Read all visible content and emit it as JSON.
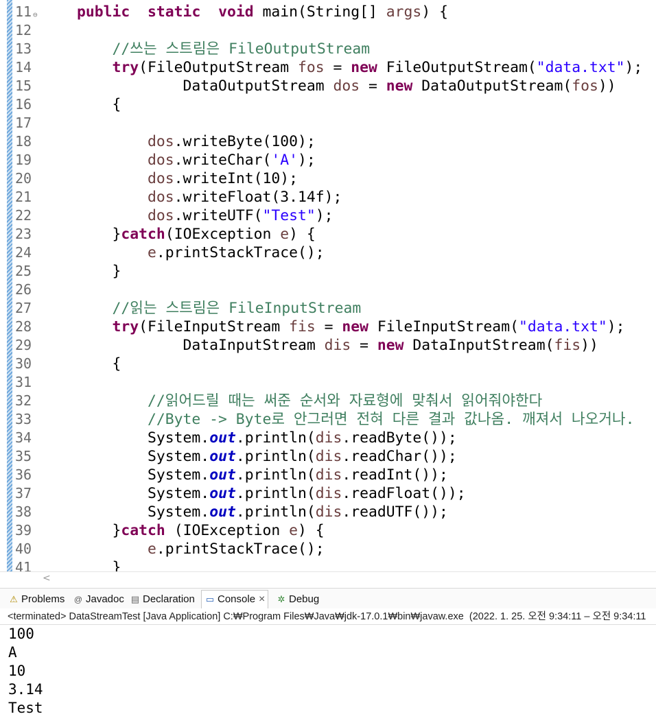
{
  "editor": {
    "lines": [
      {
        "num": "11",
        "fold": "⊖",
        "segs": [
          [
            "kw",
            "public"
          ],
          [
            "",
            "  "
          ],
          [
            "kw",
            "static"
          ],
          [
            "",
            "  "
          ],
          [
            "kw",
            "void"
          ],
          [
            "",
            " main(String[] "
          ],
          [
            "var",
            "args"
          ],
          [
            "",
            ") {"
          ]
        ]
      },
      {
        "num": "12",
        "segs": []
      },
      {
        "num": "13",
        "segs": [
          [
            "cmt",
            "    //쓰는 스트림은 FileOutputStream"
          ]
        ]
      },
      {
        "num": "14",
        "segs": [
          [
            "",
            "    "
          ],
          [
            "kw",
            "try"
          ],
          [
            "",
            "(FileOutputStream "
          ],
          [
            "var",
            "fos"
          ],
          [
            "",
            " = "
          ],
          [
            "kw",
            "new"
          ],
          [
            "",
            " FileOutputStream("
          ],
          [
            "str",
            "\"data.txt\""
          ],
          [
            "",
            ");"
          ]
        ]
      },
      {
        "num": "15",
        "segs": [
          [
            "",
            "            DataOutputStream "
          ],
          [
            "var",
            "dos"
          ],
          [
            "",
            " = "
          ],
          [
            "kw",
            "new"
          ],
          [
            "",
            " DataOutputStream("
          ],
          [
            "var",
            "fos"
          ],
          [
            "",
            "))"
          ]
        ]
      },
      {
        "num": "16",
        "segs": [
          [
            "",
            "    {"
          ]
        ]
      },
      {
        "num": "17",
        "segs": []
      },
      {
        "num": "18",
        "segs": [
          [
            "",
            "        "
          ],
          [
            "var",
            "dos"
          ],
          [
            "",
            ".writeByte(100);"
          ]
        ]
      },
      {
        "num": "19",
        "segs": [
          [
            "",
            "        "
          ],
          [
            "var",
            "dos"
          ],
          [
            "",
            ".writeChar("
          ],
          [
            "str",
            "'A'"
          ],
          [
            "",
            ");"
          ]
        ]
      },
      {
        "num": "20",
        "segs": [
          [
            "",
            "        "
          ],
          [
            "var",
            "dos"
          ],
          [
            "",
            ".writeInt(10);"
          ]
        ]
      },
      {
        "num": "21",
        "segs": [
          [
            "",
            "        "
          ],
          [
            "var",
            "dos"
          ],
          [
            "",
            ".writeFloat(3.14f);"
          ]
        ]
      },
      {
        "num": "22",
        "segs": [
          [
            "",
            "        "
          ],
          [
            "var",
            "dos"
          ],
          [
            "",
            ".writeUTF("
          ],
          [
            "str",
            "\"Test\""
          ],
          [
            "",
            ");"
          ]
        ]
      },
      {
        "num": "23",
        "segs": [
          [
            "",
            "    }"
          ],
          [
            "kw",
            "catch"
          ],
          [
            "",
            "(IOException "
          ],
          [
            "var",
            "e"
          ],
          [
            "",
            ") {"
          ]
        ]
      },
      {
        "num": "24",
        "segs": [
          [
            "",
            "        "
          ],
          [
            "var",
            "e"
          ],
          [
            "",
            ".printStackTrace();"
          ]
        ]
      },
      {
        "num": "25",
        "segs": [
          [
            "",
            "    }"
          ]
        ]
      },
      {
        "num": "26",
        "segs": []
      },
      {
        "num": "27",
        "segs": [
          [
            "cmt",
            "    //읽는 스트림은 FileInputStream"
          ]
        ]
      },
      {
        "num": "28",
        "segs": [
          [
            "",
            "    "
          ],
          [
            "kw",
            "try"
          ],
          [
            "",
            "(FileInputStream "
          ],
          [
            "var",
            "fis"
          ],
          [
            "",
            " = "
          ],
          [
            "kw",
            "new"
          ],
          [
            "",
            " FileInputStream("
          ],
          [
            "str",
            "\"data.txt\""
          ],
          [
            "",
            ");"
          ]
        ]
      },
      {
        "num": "29",
        "segs": [
          [
            "",
            "            DataInputStream "
          ],
          [
            "var",
            "dis"
          ],
          [
            "",
            " = "
          ],
          [
            "kw",
            "new"
          ],
          [
            "",
            " DataInputStream("
          ],
          [
            "var",
            "fis"
          ],
          [
            "",
            "))"
          ]
        ]
      },
      {
        "num": "30",
        "segs": [
          [
            "",
            "    {"
          ]
        ]
      },
      {
        "num": "31",
        "segs": []
      },
      {
        "num": "32",
        "segs": [
          [
            "cmt",
            "        //읽어드릴 때는 써준 순서와 자료형에 맞춰서 읽어줘야한다"
          ]
        ]
      },
      {
        "num": "33",
        "segs": [
          [
            "cmt",
            "        //Byte -> Byte로 안그러면 전혀 다른 결과 값나옴. 깨져서 나오거나."
          ]
        ]
      },
      {
        "num": "34",
        "segs": [
          [
            "",
            "        System."
          ],
          [
            "fld",
            "out"
          ],
          [
            "",
            ".println("
          ],
          [
            "var",
            "dis"
          ],
          [
            "",
            ".readByte());"
          ]
        ]
      },
      {
        "num": "35",
        "segs": [
          [
            "",
            "        System."
          ],
          [
            "fld",
            "out"
          ],
          [
            "",
            ".println("
          ],
          [
            "var",
            "dis"
          ],
          [
            "",
            ".readChar());"
          ]
        ]
      },
      {
        "num": "36",
        "segs": [
          [
            "",
            "        System."
          ],
          [
            "fld",
            "out"
          ],
          [
            "",
            ".println("
          ],
          [
            "var",
            "dis"
          ],
          [
            "",
            ".readInt());"
          ]
        ]
      },
      {
        "num": "37",
        "segs": [
          [
            "",
            "        System."
          ],
          [
            "fld",
            "out"
          ],
          [
            "",
            ".println("
          ],
          [
            "var",
            "dis"
          ],
          [
            "",
            ".readFloat());"
          ]
        ]
      },
      {
        "num": "38",
        "segs": [
          [
            "",
            "        System."
          ],
          [
            "fld",
            "out"
          ],
          [
            "",
            ".println("
          ],
          [
            "var",
            "dis"
          ],
          [
            "",
            ".readUTF());"
          ]
        ]
      },
      {
        "num": "39",
        "segs": [
          [
            "",
            "    }"
          ],
          [
            "kw",
            "catch"
          ],
          [
            "",
            " (IOException "
          ],
          [
            "var",
            "e"
          ],
          [
            "",
            ") {"
          ]
        ]
      },
      {
        "num": "40",
        "segs": [
          [
            "",
            "        "
          ],
          [
            "var",
            "e"
          ],
          [
            "",
            ".printStackTrace();"
          ]
        ]
      },
      {
        "num": "41",
        "segs": [
          [
            "",
            "    }"
          ]
        ]
      }
    ]
  },
  "scroll_left": "<",
  "tabs": [
    {
      "icon": "problems-icon",
      "glyph": "⚠",
      "label": "Problems"
    },
    {
      "icon": "javadoc-icon",
      "glyph": "@",
      "label": "Javadoc"
    },
    {
      "icon": "declaration-icon",
      "glyph": "▤",
      "label": "Declaration"
    },
    {
      "icon": "console-icon",
      "glyph": "▭",
      "label": "Console",
      "close": "×"
    },
    {
      "icon": "debug-icon",
      "glyph": "✲",
      "label": "Debug"
    }
  ],
  "status_line": "<terminated> DataStreamTest [Java Application] C:₩Program Files₩Java₩jdk-17.0.1₩bin₩javaw.exe  (2022. 1. 25. 오전 9:34:11 – 오전 9:34:11",
  "console_output": [
    "100",
    "A",
    "10",
    "3.14",
    "Test"
  ]
}
